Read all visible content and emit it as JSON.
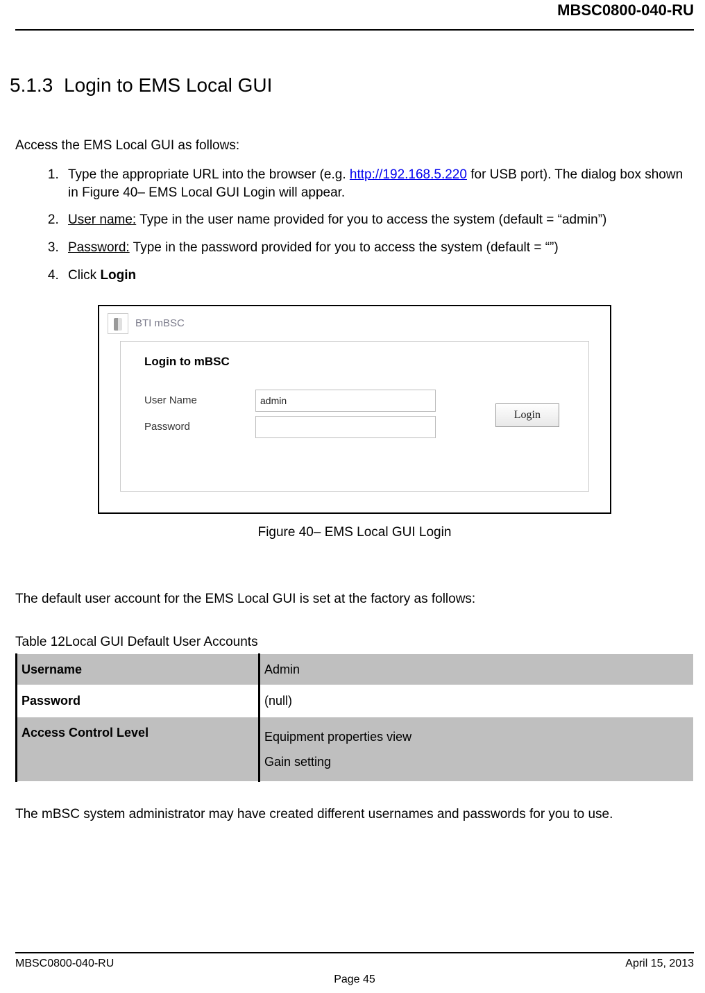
{
  "header": {
    "doc_id": "MBSC0800-040-RU"
  },
  "section": {
    "number": "5.1.3",
    "title": "Login to EMS Local GUI"
  },
  "intro": "Access the EMS Local GUI as follows:",
  "steps": {
    "step1": {
      "prefix": "Type the appropriate URL into the browser (e.g. ",
      "url": "http://192.168.5.220",
      "suffix": " for USB port). The dialog box shown in Figure 40– EMS Local GUI Login will appear."
    },
    "step2": {
      "term": "User name:",
      "rest": " Type in the user name provided for you to access the system (default = “admin”)"
    },
    "step3": {
      "term": "Password:",
      "rest": " Type in the password provided for you to access the system (default = “”)"
    },
    "step4": {
      "prefix": "Click ",
      "bold": "Login"
    }
  },
  "figure": {
    "app_title": "BTI mBSC",
    "login_heading": "Login to mBSC",
    "username_label": "User Name",
    "password_label": "Password",
    "username_value": "admin",
    "login_button": "Login",
    "caption": "Figure 40– EMS Local GUI Login"
  },
  "para_after_figure": "The default user account for the EMS Local GUI is set at the factory as follows:",
  "table": {
    "caption": "Table 12Local GUI Default User Accounts",
    "rows": {
      "r1": {
        "label": "Username",
        "value": "Admin"
      },
      "r2": {
        "label": "Password",
        "value": "(null)"
      },
      "r3": {
        "label": "Access Control Level",
        "value_line1": "Equipment properties view",
        "value_line2": "Gain setting"
      }
    }
  },
  "closing": "The mBSC system administrator may have created different usernames and passwords for you to use.",
  "footer": {
    "left": "MBSC0800-040-RU",
    "right": "April 15, 2013",
    "page": "Page 45"
  }
}
